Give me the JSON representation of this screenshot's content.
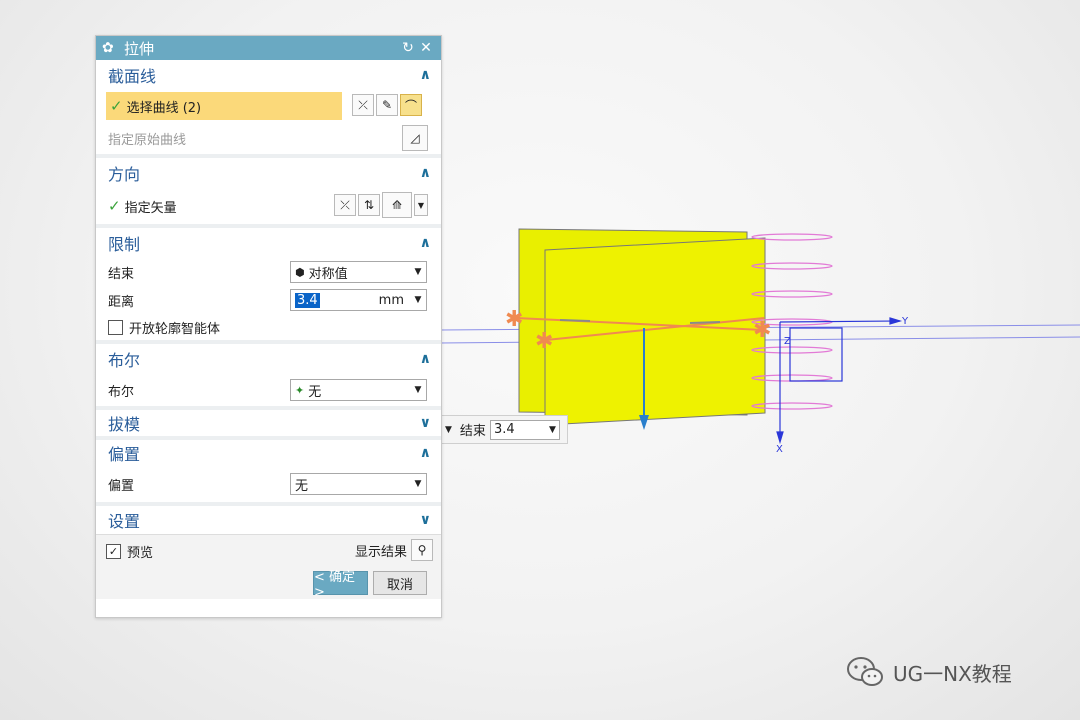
{
  "dialog": {
    "title": "拉伸",
    "sections": {
      "section_curve": {
        "title": "截面线",
        "select_curve": "选择曲线 (2)",
        "original_curve": "指定原始曲线"
      },
      "direction": {
        "title": "方向",
        "vector": "指定矢量"
      },
      "limits": {
        "title": "限制",
        "end_label": "结束",
        "end_value": "对称值",
        "distance_label": "距离",
        "distance_value": "3.4",
        "distance_unit": "mm",
        "open_profile": "开放轮廓智能体"
      },
      "boolean": {
        "title": "布尔",
        "label": "布尔",
        "value": "无"
      },
      "draft": {
        "title": "拔模"
      },
      "offset": {
        "title": "偏置",
        "label": "偏置",
        "value": "无"
      },
      "settings": {
        "title": "设置"
      }
    },
    "preview_label": "预览",
    "show_result_label": "显示结果",
    "ok_label": "< 确定 >",
    "cancel_label": "取消"
  },
  "viewport": {
    "float_end_label": "结束",
    "float_end_value": "3.4",
    "axis_y": "Y",
    "axis_z": "Z",
    "axis_x": "X"
  },
  "watermark": "UG一NX教程",
  "colors": {
    "title_bar": "#6aa9c2",
    "selection": "#fbd97a",
    "ok_button": "#6aa9c2",
    "sheet": "#eef000"
  }
}
